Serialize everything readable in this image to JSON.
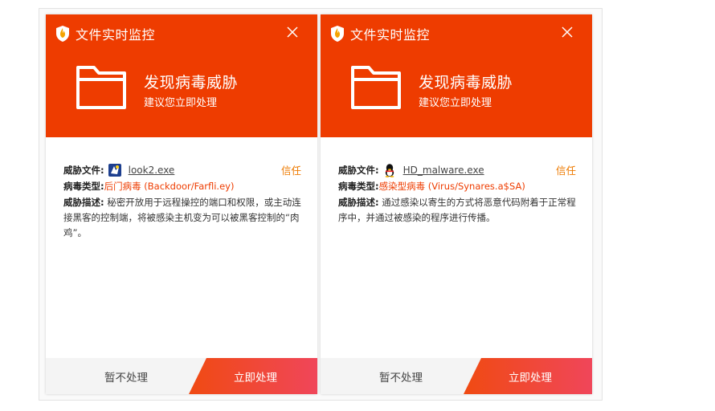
{
  "colors": {
    "header_bg": "#ee3c00",
    "trust_link": "#ee7a00",
    "virus_type": "#ee3c00",
    "primary_button_gradient": [
      "#f04a12",
      "#f0465a"
    ]
  },
  "popups": [
    {
      "title": "文件实时监控",
      "alert_title": "发现病毒威胁",
      "alert_subtitle": "建议您立即处理",
      "file_label": "威胁文件:",
      "file_icon": "app-icon",
      "file_name": "look2.exe",
      "trust_label": "信任",
      "type_label": "病毒类型:",
      "type_value": "后门病毒 (Backdoor/Farfli.ey)",
      "desc_label": "威胁描述:",
      "desc_value": "秘密开放用于远程操控的端口和权限，或主动连接黑客的控制端，将被感染主机变为可以被黑客控制的“肉鸡”。",
      "later_button": "暂不处理",
      "now_button": "立即处理"
    },
    {
      "title": "文件实时监控",
      "alert_title": "发现病毒威胁",
      "alert_subtitle": "建议您立即处理",
      "file_label": "威胁文件:",
      "file_icon": "penguin-icon",
      "file_name": "HD_malware.exe",
      "trust_label": "信任",
      "type_label": "病毒类型:",
      "type_value": "感染型病毒 (Virus/Synares.a$SA)",
      "desc_label": "威胁描述:",
      "desc_value": "通过感染以寄生的方式将恶意代码附着于正常程序中，并通过被感染的程序进行传播。",
      "later_button": "暂不处理",
      "now_button": "立即处理"
    }
  ]
}
